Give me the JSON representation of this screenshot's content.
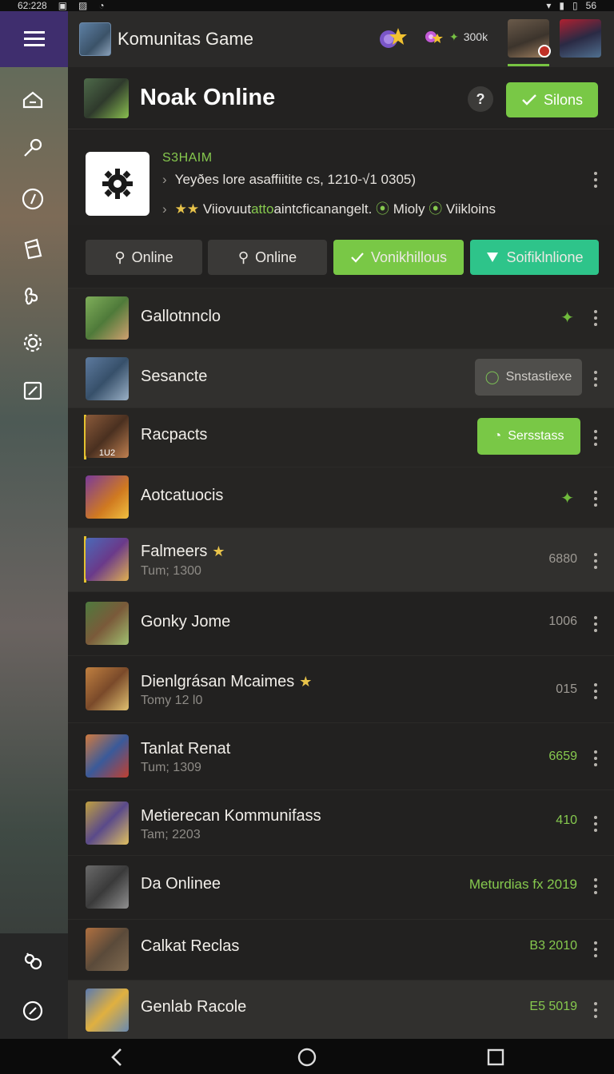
{
  "status_bar": {
    "time": "62:228",
    "right": "56"
  },
  "header": {
    "title": "Komunitas Game",
    "stat": "300k"
  },
  "page": {
    "title": "Noak Online",
    "help": "?",
    "primary_button": "Silons"
  },
  "info": {
    "name": "S3HAIM",
    "line1": "Yeyðes lore asaffiitite cs, 1210-√1 0305)",
    "line2_prefix": "★★",
    "line2_text_a": "Viiovuut",
    "line2_text_green": "atto",
    "line2_text_b": "aintcficanangelt.",
    "line2_tag1": "Mioly",
    "line2_tag2": "Viikloins"
  },
  "chips": [
    {
      "label": "Online",
      "style": "dark",
      "icon": "pin-icon"
    },
    {
      "label": "Online",
      "style": "dark",
      "icon": "pin-icon"
    },
    {
      "label": "Vonikhillous",
      "style": "green",
      "icon": "check-icon"
    },
    {
      "label": "Soifiklnlione",
      "style": "teal",
      "icon": "shield-icon"
    }
  ],
  "rows": [
    {
      "name": "Gallotnnclo",
      "sub": "",
      "value": "",
      "action": "spark"
    },
    {
      "name": "Sesancte",
      "sub": "",
      "value": "",
      "action": "button",
      "button_label": "Snstastiexe",
      "button_style": "gray"
    },
    {
      "name": "Racpacts",
      "sub": "",
      "value": "",
      "action": "button",
      "button_label": "Sersstass",
      "button_style": "green",
      "thumb_label": "1U2"
    },
    {
      "name": "Aotcatuocis",
      "sub": "",
      "value": "",
      "action": "spark"
    },
    {
      "name": "Falmeers",
      "sub": "Tum; 1300",
      "value": "6880",
      "star": true
    },
    {
      "name": "Gonky Jome",
      "sub": "",
      "value": "1006"
    },
    {
      "name": "Dienlgrásan Mcaimes",
      "sub": "Tomy 12 l0",
      "value": "015",
      "star": true
    },
    {
      "name": "Tanlat Renat",
      "sub": "Tum; 1309",
      "value": "6659",
      "green": true
    },
    {
      "name": "Metierecan Kommunifass",
      "sub": "Tam; 2203",
      "value": "410",
      "green": true
    },
    {
      "name": "Da Onlinee",
      "sub": "",
      "value": "Meturdias fx 2019",
      "green": true
    },
    {
      "name": "Calkat Reclas",
      "sub": "",
      "value": "B3 2010",
      "green": true
    },
    {
      "name": "Genlab Racole",
      "sub": "",
      "value": "E5 5019",
      "green": true
    }
  ],
  "colors": {
    "accent_green": "#79c846",
    "teal": "#2ec48a",
    "purple_rail": "#3f2e6e"
  }
}
